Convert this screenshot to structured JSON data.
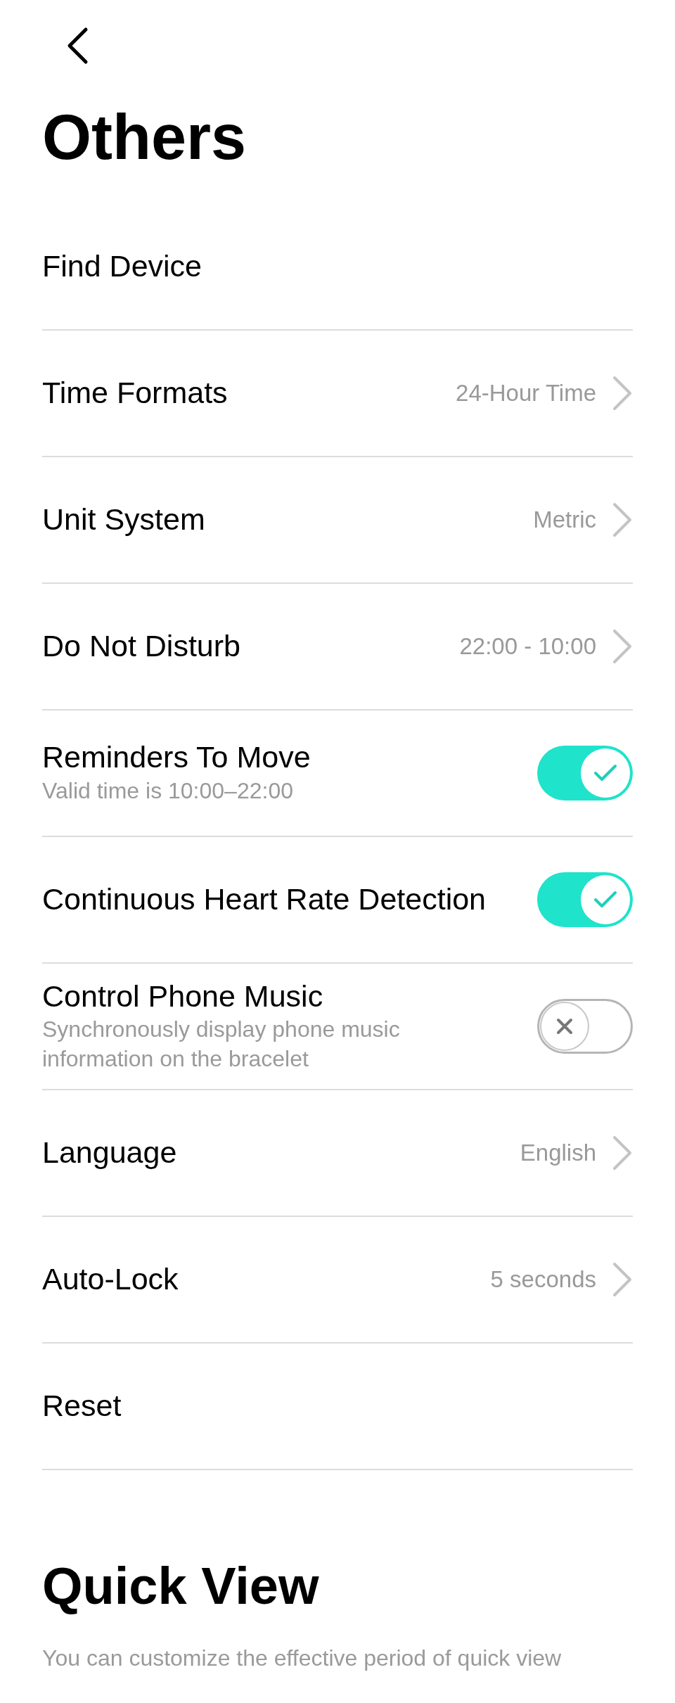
{
  "title": "Others",
  "rows": [
    {
      "kind": "plain",
      "label": "Find Device"
    },
    {
      "kind": "value",
      "label": "Time Formats",
      "value": "24-Hour Time"
    },
    {
      "kind": "value",
      "label": "Unit System",
      "value": "Metric"
    },
    {
      "kind": "value",
      "label": "Do Not Disturb",
      "value": "22:00 - 10:00"
    },
    {
      "kind": "toggle",
      "label": "Reminders To Move",
      "sublabel": "Valid time is 10:00–22:00",
      "on": true
    },
    {
      "kind": "toggle",
      "label": "Continuous Heart Rate Detection",
      "on": true
    },
    {
      "kind": "toggle",
      "label": "Control Phone Music",
      "sublabel": "Synchronously display phone music information on the bracelet",
      "on": false
    },
    {
      "kind": "value",
      "label": "Language",
      "value": "English"
    },
    {
      "kind": "value",
      "label": "Auto-Lock",
      "value": "5 seconds"
    },
    {
      "kind": "plain",
      "label": "Reset"
    }
  ],
  "quick_view": {
    "title": "Quick View",
    "description": "You can customize the effective period of quick view"
  }
}
